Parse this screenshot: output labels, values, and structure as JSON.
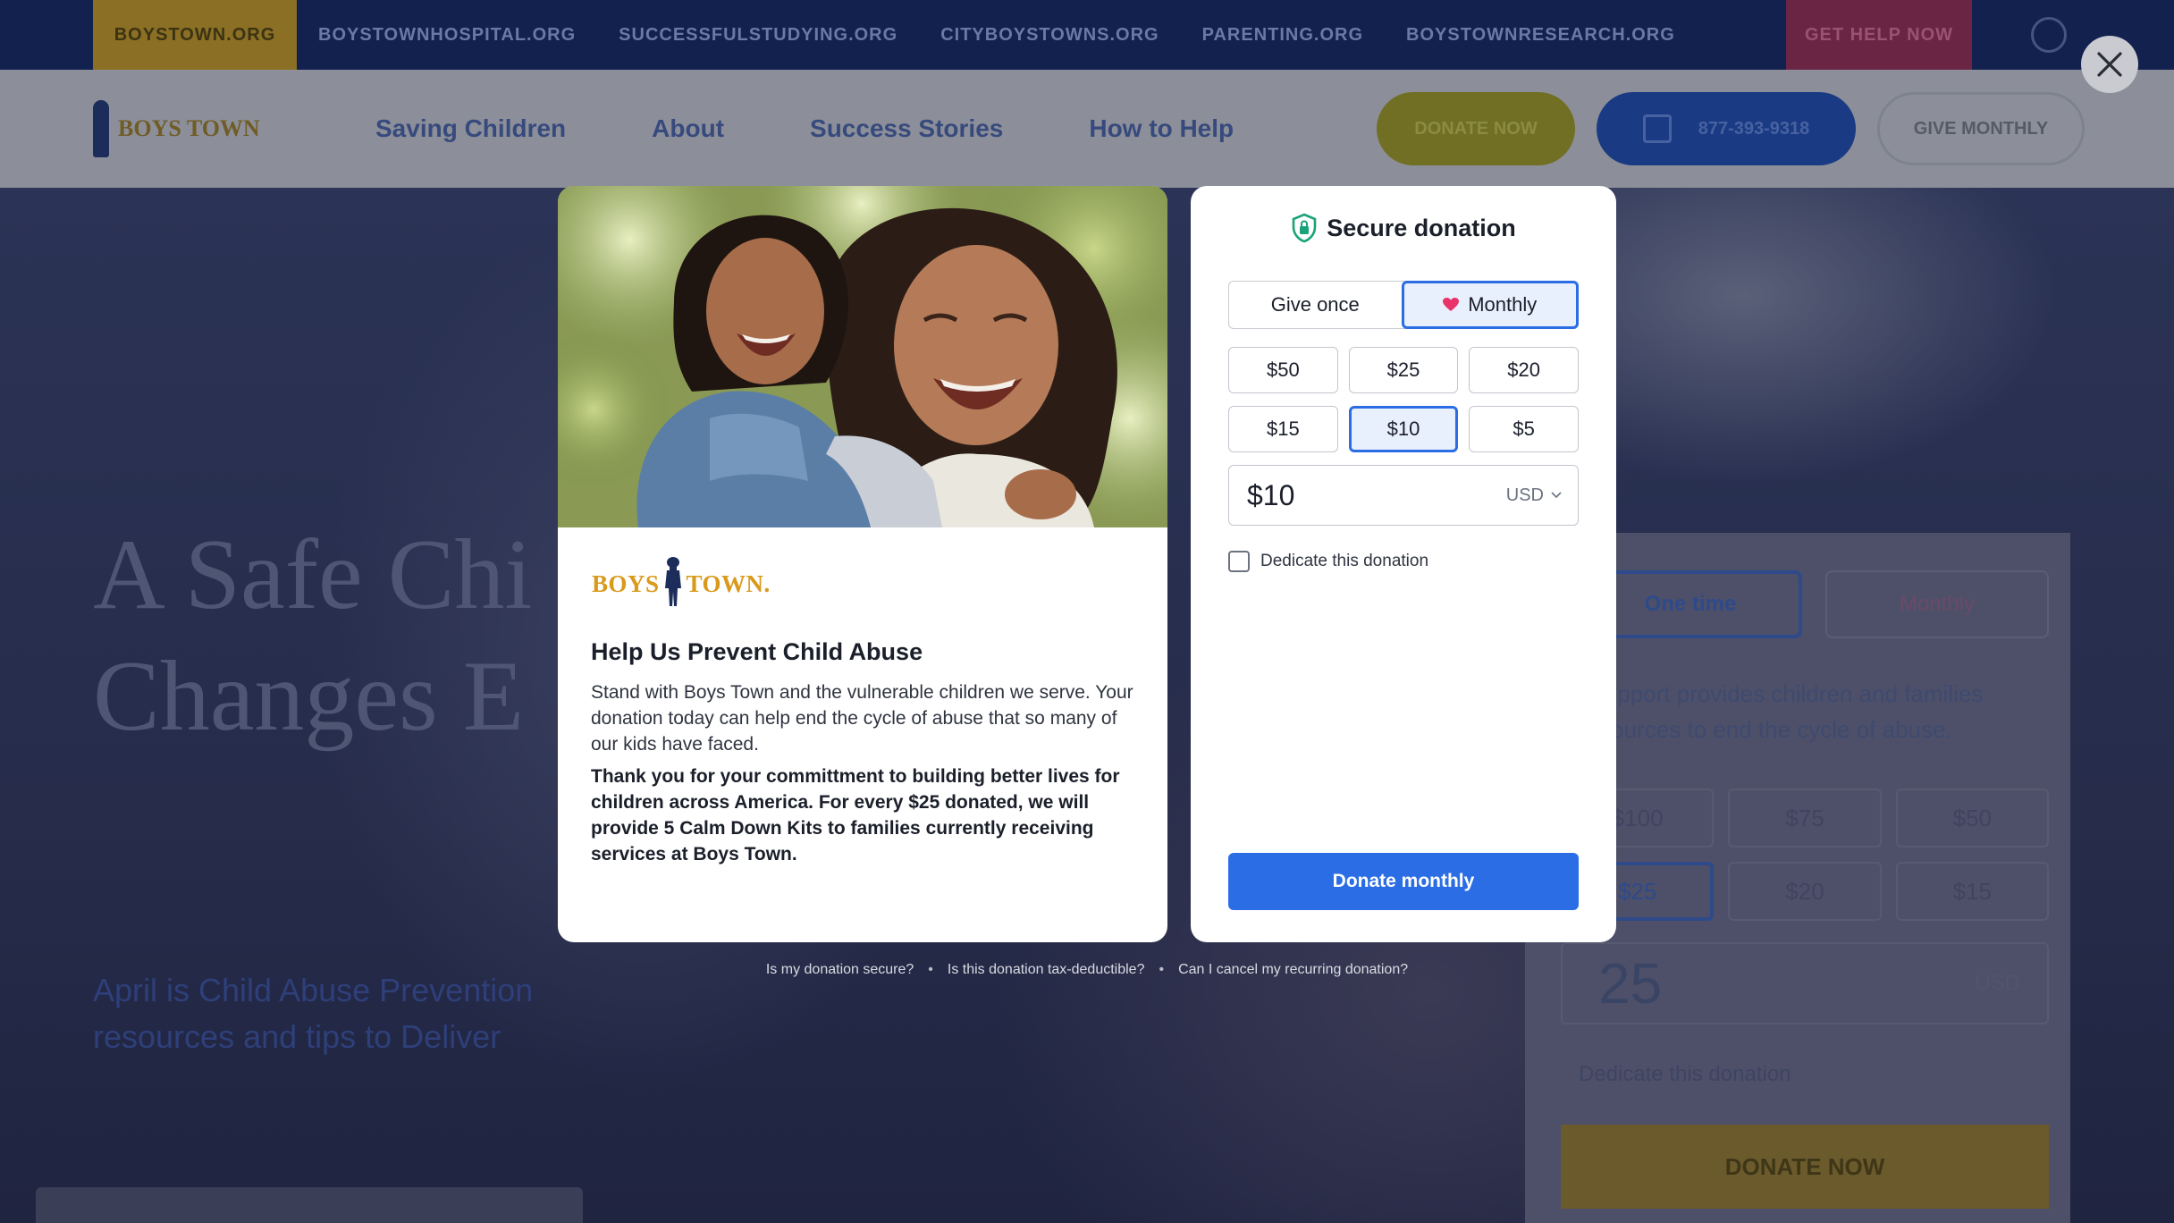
{
  "background": {
    "top_strip": [
      "BOYSTOWN.ORG",
      "BOYSTOWNHOSPITAL.ORG",
      "SUCCESSFULSTUDYING.ORG",
      "CITYBOYSTOWNS.ORG",
      "PARENTING.ORG",
      "BOYSTOWNRESEARCH.ORG"
    ],
    "get_help": "GET HELP NOW",
    "nav": {
      "logo": "BOYS TOWN",
      "links": [
        "Saving Children",
        "About",
        "Success Stories",
        "How to Help"
      ],
      "donate": "DONATE NOW",
      "phone": "877-393-9318",
      "monthly": "GIVE MONTHLY"
    },
    "hero": {
      "title_line1": "A Safe Chi",
      "title_line2": "Changes E",
      "sub": "April is Child Abuse Prevention resources and tips to Deliver"
    },
    "form": {
      "tab_once": "One time",
      "tab_monthly": "Monthly",
      "text": "r support provides children and families resources to end the cycle of abuse.",
      "amounts": [
        "$100",
        "$75",
        "$50",
        "$25",
        "$20",
        "$15"
      ],
      "amount_value": "25",
      "currency": "USD",
      "dedicate": "Dedicate this donation",
      "button": "DONATE NOW"
    }
  },
  "story": {
    "logo_left": "BOYS",
    "logo_right": "TOWN.",
    "title": "Help Us Prevent Child Abuse",
    "paragraph1": "Stand with Boys Town and the vulnerable children we serve. Your donation today can help end the cycle of abuse that so many of our kids have faced.",
    "paragraph2": "Thank you for your committment to building better lives for children across America. For every $25 donated, we will provide 5 Calm Down Kits to families currently receiving services at Boys Town."
  },
  "donation": {
    "header": "Secure donation",
    "frequency": [
      {
        "label": "Give once",
        "selected": false
      },
      {
        "label": "Monthly",
        "selected": true
      }
    ],
    "amounts": [
      {
        "label": "$50",
        "selected": false
      },
      {
        "label": "$25",
        "selected": false
      },
      {
        "label": "$20",
        "selected": false
      },
      {
        "label": "$15",
        "selected": false
      },
      {
        "label": "$10",
        "selected": true
      },
      {
        "label": "$5",
        "selected": false
      }
    ],
    "amount_value": "$10",
    "currency": "USD",
    "dedicate_label": "Dedicate this donation",
    "dedicate_checked": false,
    "submit_label": "Donate monthly"
  },
  "faq": {
    "secure": "Is my donation secure?",
    "tax": "Is this donation tax-deductible?",
    "cancel": "Can I cancel my recurring donation?",
    "separator": "•"
  },
  "colors": {
    "accent": "#2b6de4",
    "brand_gold": "#d99a1c",
    "brand_navy": "#1c2d5b",
    "shield": "#1aa37a",
    "heart": "#e8336b"
  },
  "icons": {
    "close": "close-icon",
    "shield": "shield-lock-icon",
    "heart": "heart-icon",
    "chevron": "chevron-down-icon"
  }
}
